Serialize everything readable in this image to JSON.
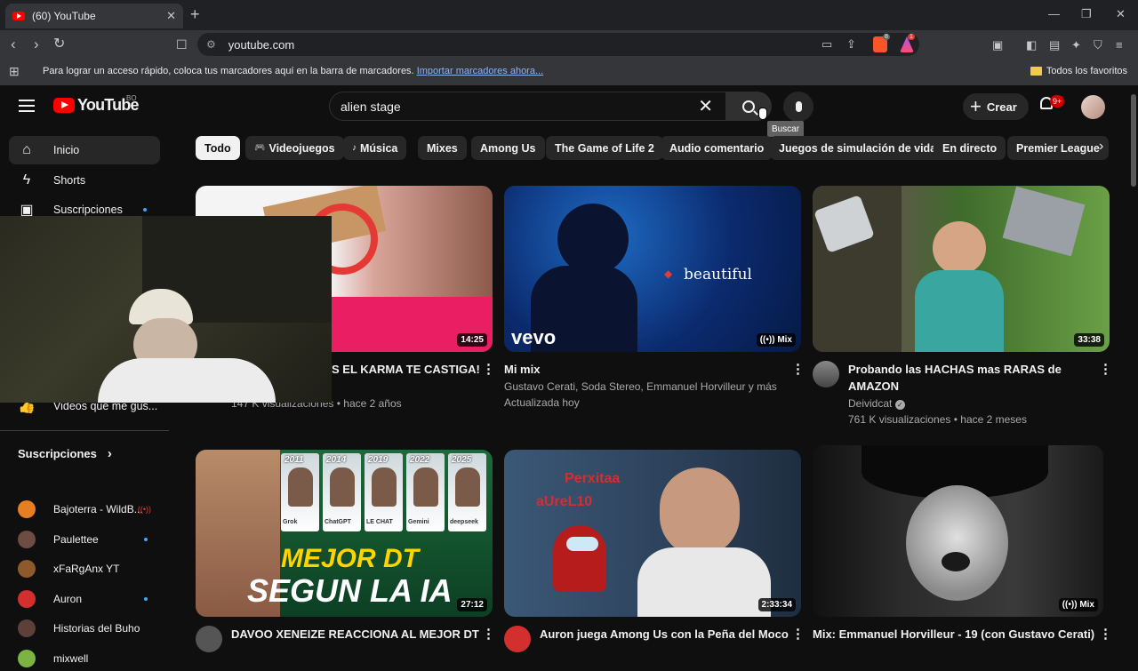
{
  "browser": {
    "tab_title": "(60) YouTube",
    "tab_close": "✕",
    "new_tab": "+",
    "window_controls": [
      "—",
      "❐",
      "✕"
    ],
    "url": "youtube.com",
    "brave_shield_count": "8",
    "rewards_count": "1",
    "bookmarks_message": "Para lograr un acceso rápido, coloca tus marcadores aquí en la barra de marcadores.",
    "bookmarks_import": "Importar marcadores ahora...",
    "all_favorites": "Todos los favoritos"
  },
  "header": {
    "logo_text": "YouTube",
    "logo_country": "BO",
    "search_value": "alien stage",
    "search_tooltip": "Buscar",
    "create_label": "Crear",
    "notifications_badge": "9+"
  },
  "sidebar": {
    "items": [
      {
        "label": "Inicio",
        "icon": "home-icon"
      },
      {
        "label": "Shorts",
        "icon": "shorts-icon"
      },
      {
        "label": "Suscripciones",
        "icon": "subscriptions-icon"
      }
    ],
    "liked_label": "Videos que me gus...",
    "subscriptions_header": "Suscripciones",
    "subscriptions": [
      {
        "name": "Bajoterra - WildB...",
        "color": "#e67e22"
      },
      {
        "name": "Paulettee",
        "color": "#6d4c41"
      },
      {
        "name": "xFaRgAnx YT",
        "color": "#8e5a2b"
      },
      {
        "name": "Auron",
        "color": "#d32f2f"
      },
      {
        "name": "Historias del Buho",
        "color": "#5d4037"
      },
      {
        "name": "mixwell",
        "color": "#7cb342"
      }
    ]
  },
  "chips": [
    "Todo",
    "Videojuegos",
    "Música",
    "Mixes",
    "Among Us",
    "The Game of Life 2",
    "Audio comentario",
    "Juegos de simulación de vida",
    "En directo",
    "Premier League"
  ],
  "videos": [
    {
      "title": "S EL KARMA TE CASTIGA!",
      "meta1": "147 K visualizaciones • hace 2 años",
      "duration": "14:25"
    },
    {
      "title": "Mi mix",
      "meta1": "Gustavo Cerati, Soda Stereo, Emmanuel Horvilleur y más",
      "meta2": "Actualizada hoy",
      "badge": "Mix",
      "overlay_text": "beautiful",
      "vevo": "vevo"
    },
    {
      "title_line1": "Probando las HACHAS mas RARAS de",
      "title_line2": "AMAZON",
      "channel": "Deividcat",
      "meta2": "761 K visualizaciones • hace 2 meses",
      "duration": "33:38"
    },
    {
      "title": "DAVOO XENEIZE REACCIONA AL MEJOR DT",
      "duration": "27:12",
      "thumb_line1": "MEJOR DT",
      "thumb_line2": "SEGUN LA IA",
      "years": [
        "2011",
        "2014",
        "2019",
        "2022",
        "2025"
      ],
      "ais": [
        "Grok",
        "ChatGPT",
        "LE CHAT",
        "Gemini",
        "deepseek"
      ]
    },
    {
      "title": "Auron juega Among Us con la Peña del Moco",
      "duration": "2:33:34",
      "tag1": "Perxitaa",
      "tag2": "aUreL10"
    },
    {
      "title": "Mix: Emmanuel Horvilleur - 19 (con Gustavo Cerati)",
      "badge": "Mix"
    }
  ]
}
